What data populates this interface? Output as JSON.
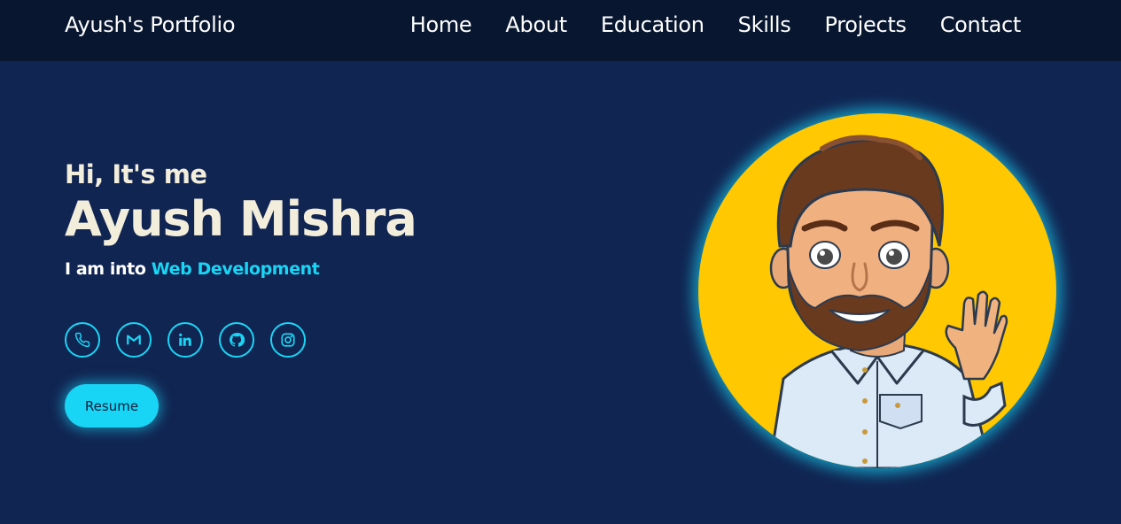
{
  "nav": {
    "brand": "Ayush's Portfolio",
    "links": [
      "Home",
      "About",
      "Education",
      "Skills",
      "Projects",
      "Contact"
    ]
  },
  "hero": {
    "greeting": "Hi, It's me",
    "name": "Ayush Mishra",
    "tagline_prefix": "I am into",
    "tagline_highlight": "Web Development",
    "resume_label": "Resume"
  },
  "socials": [
    {
      "icon": "phone-icon"
    },
    {
      "icon": "gmail-icon"
    },
    {
      "icon": "linkedin-icon"
    },
    {
      "icon": "github-icon"
    },
    {
      "icon": "instagram-icon"
    }
  ],
  "colors": {
    "background": "#112552",
    "navbar": "#081630",
    "accent": "#19d5f5",
    "text": "#f3eedb",
    "avatar_bg": "#ffc800"
  }
}
